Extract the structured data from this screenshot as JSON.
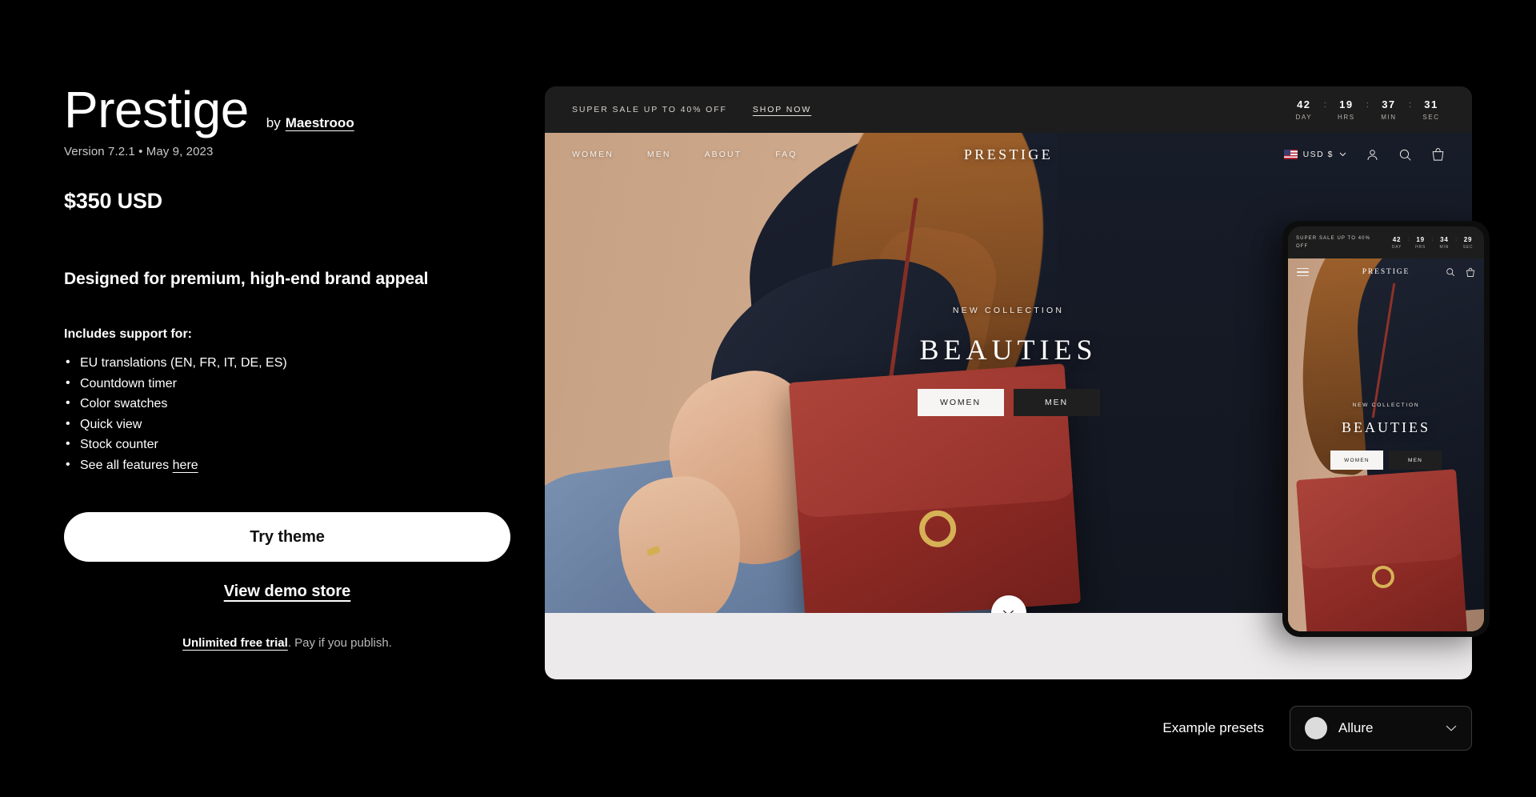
{
  "theme": {
    "name": "Prestige",
    "by_prefix": "by",
    "author": "Maestrooo",
    "version_line": "Version 7.2.1 • May 9, 2023",
    "price": "$350 USD",
    "tagline": "Designed for premium, high-end brand appeal",
    "includes_label": "Includes support for:",
    "features": [
      "EU translations (EN, FR, IT, DE, ES)",
      "Countdown timer",
      "Color swatches",
      "Quick view",
      "Stock counter"
    ],
    "last_feature_prefix": "See all features",
    "last_feature_link": "here",
    "try_button": "Try theme",
    "demo_link": "View demo store",
    "trial_strong": "Unlimited free trial",
    "trial_rest": ". Pay if you publish."
  },
  "preview": {
    "announcement": {
      "text": "SUPER SALE UP TO 40% OFF",
      "link": "SHOP NOW"
    },
    "countdown": [
      {
        "value": "42",
        "label": "DAY"
      },
      {
        "value": "19",
        "label": "HRS"
      },
      {
        "value": "37",
        "label": "MIN"
      },
      {
        "value": "31",
        "label": "SEC"
      }
    ],
    "countdown_separator": ":",
    "nav": [
      "WOMEN",
      "MEN",
      "ABOUT",
      "FAQ"
    ],
    "logo": "PRESTIGE",
    "currency": "USD $",
    "currency_flag": "us-flag-icon",
    "icons": [
      "account-icon",
      "search-icon",
      "cart-icon"
    ],
    "hero": {
      "kicker": "NEW COLLECTION",
      "title": "BEAUTIES",
      "button_women": "WOMEN",
      "button_men": "MEN"
    },
    "scroll_icon": "chevron-down-icon"
  },
  "mobile": {
    "announcement": "SUPER SALE UP TO 40% OFF",
    "countdown": [
      {
        "value": "42",
        "label": "DAY"
      },
      {
        "value": "19",
        "label": "HRS"
      },
      {
        "value": "34",
        "label": "MIN"
      },
      {
        "value": "29",
        "label": "SEC"
      }
    ],
    "countdown_separator": ":",
    "logo": "PRESTIGE",
    "hero": {
      "kicker": "NEW COLLECTION",
      "title": "BEAUTIES",
      "button_women": "WOMEN",
      "button_men": "MEN"
    }
  },
  "presets": {
    "label": "Example presets",
    "selected": "Allure",
    "swatch_color": "#dcdcdc"
  },
  "colors": {
    "background": "#000000",
    "text": "#ffffff",
    "muted": "#b9b9b9",
    "button_bg": "#ffffff",
    "panel_dark": "#1d1d1d"
  }
}
